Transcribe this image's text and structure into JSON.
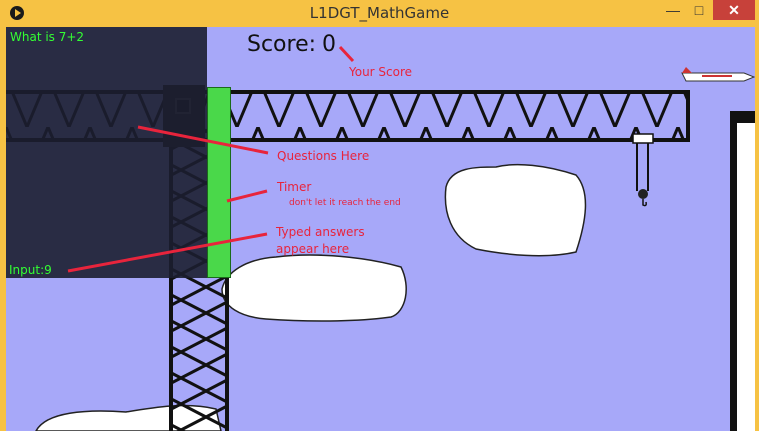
{
  "window": {
    "title": "L1DGT_MathGame",
    "minimize": "—",
    "maximize": "□",
    "close": "✕"
  },
  "hud": {
    "score_label": "Score:",
    "score_value": "0"
  },
  "question_panel": {
    "question": "What is 7+2",
    "input_label": "Input:",
    "input_value": "9"
  },
  "timer": {
    "remaining_fraction": 0.92
  },
  "annotations": {
    "your_score": "Your Score",
    "questions_here": "Questions Here",
    "timer": "Timer",
    "timer_note": "don't let it reach the end",
    "typed_answers_line1": "Typed answers",
    "typed_answers_line2": "appear here"
  },
  "colors": {
    "sky": "#a7a8f9",
    "panel": "#1c1e30",
    "hud_text": "#33ff33",
    "timer": "#4ad84a",
    "annotation": "#e8243c",
    "crane": "#111111",
    "cloud": "#ffffff"
  }
}
